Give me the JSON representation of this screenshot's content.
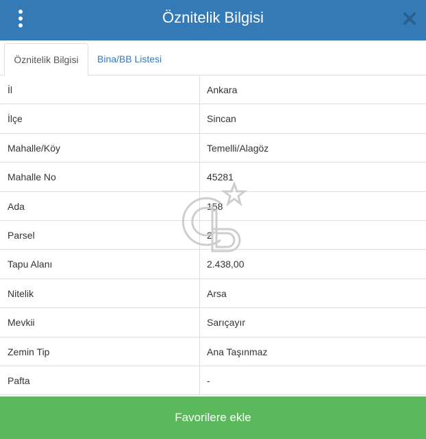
{
  "header": {
    "title": "Öznitelik Bilgisi"
  },
  "tabs": [
    {
      "label": "Öznitelik Bilgisi"
    },
    {
      "label": "Bina/BB Listesi"
    }
  ],
  "rows": [
    {
      "key": "İl",
      "value": "Ankara"
    },
    {
      "key": "İlçe",
      "value": "Sincan"
    },
    {
      "key": "Mahalle/Köy",
      "value": "Temelli/Alagöz"
    },
    {
      "key": "Mahalle No",
      "value": "45281"
    },
    {
      "key": "Ada",
      "value": "158"
    },
    {
      "key": "Parsel",
      "value": "2"
    },
    {
      "key": "Tapu Alanı",
      "value": "2.438,00"
    },
    {
      "key": "Nitelik",
      "value": "Arsa"
    },
    {
      "key": "Mevkii",
      "value": "Sarıçayır"
    },
    {
      "key": "Zemin Tip",
      "value": "Ana Taşınmaz"
    },
    {
      "key": "Pafta",
      "value": "-"
    }
  ],
  "icons": {
    "menu": "kebab-menu-icon",
    "close": "close-icon",
    "watermark": "cb-logo-watermark"
  },
  "footer": {
    "label": "Favorilere ekle"
  },
  "colors": {
    "header": "#337ab7",
    "footer": "#5cb85c",
    "tab_link": "#337ab7",
    "border": "#dddddd"
  }
}
